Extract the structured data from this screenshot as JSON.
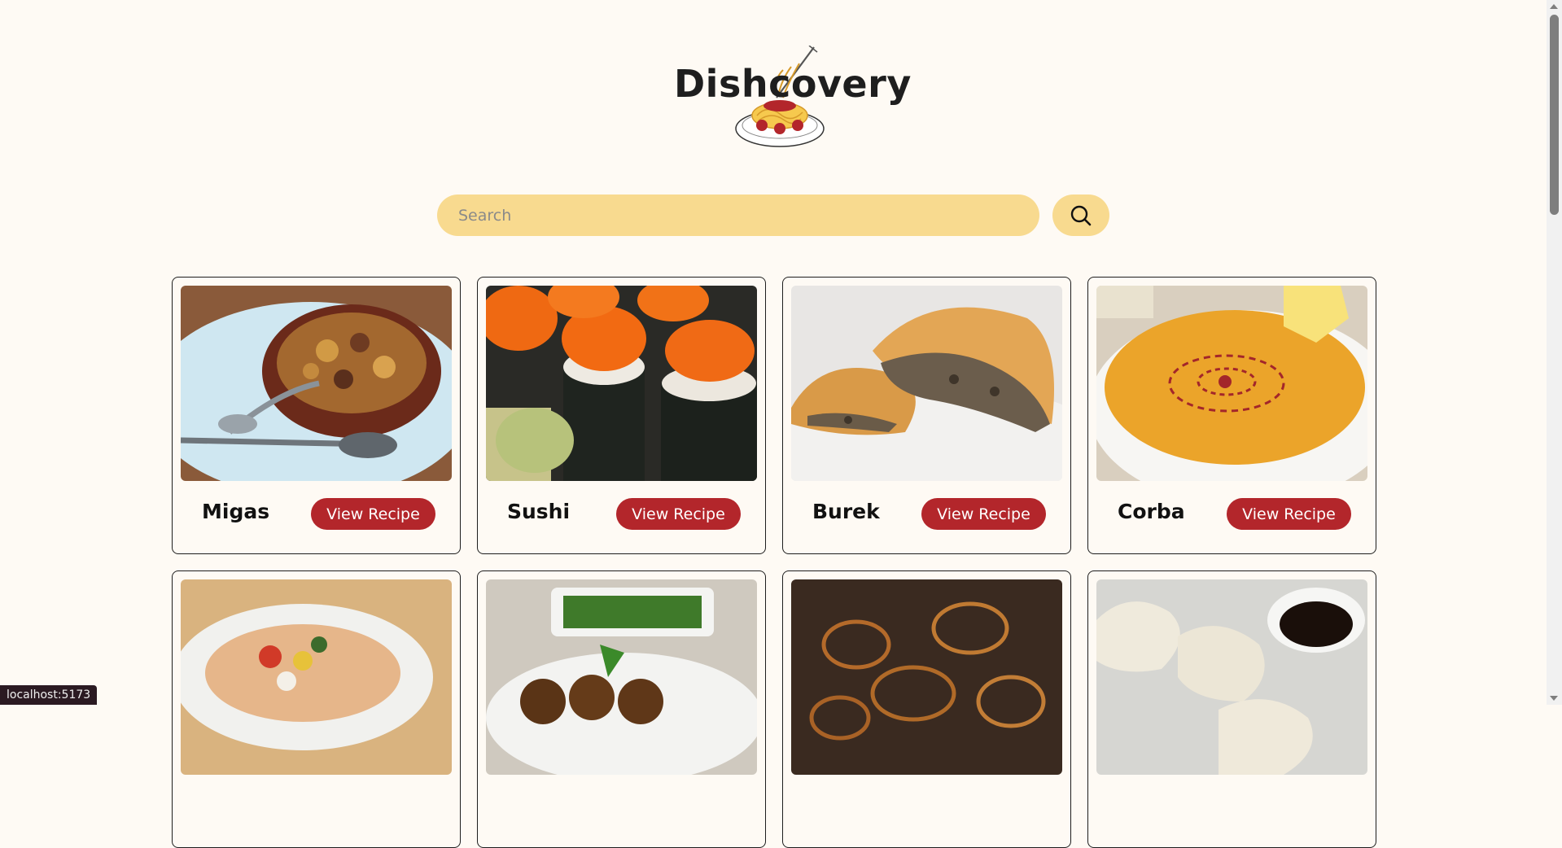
{
  "brand": {
    "name": "Dishcovery",
    "logo_icon": "spaghetti-plate-icon"
  },
  "search": {
    "placeholder": "Search",
    "value": "",
    "button_icon": "search-icon"
  },
  "recipes": [
    {
      "name": "Migas",
      "button_label": "View Recipe"
    },
    {
      "name": "Sushi",
      "button_label": "View Recipe"
    },
    {
      "name": "Burek",
      "button_label": "View Recipe"
    },
    {
      "name": "Corba",
      "button_label": "View Recipe"
    },
    {
      "name": "",
      "button_label": ""
    },
    {
      "name": "",
      "button_label": ""
    },
    {
      "name": "",
      "button_label": ""
    },
    {
      "name": "",
      "button_label": ""
    }
  ],
  "colors": {
    "accent": "#b3262b",
    "search_bg": "#f8da8f",
    "page_bg": "#fefaf4"
  },
  "status_bar": {
    "url": "localhost:5173"
  }
}
